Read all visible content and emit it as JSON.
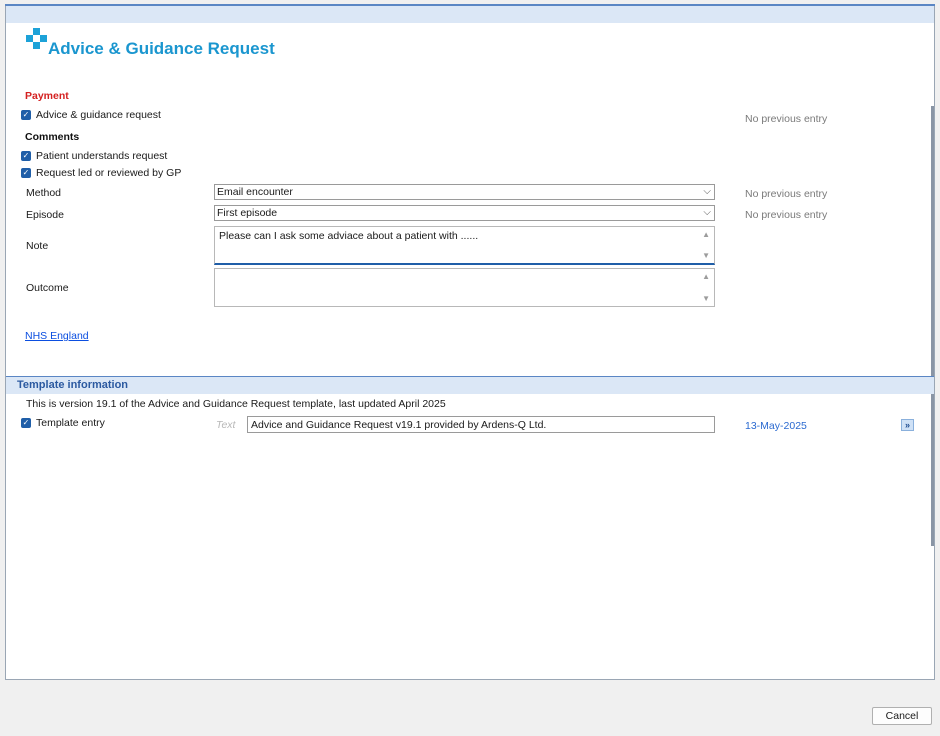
{
  "dialog": {
    "title": "Advice & Guidance Request",
    "brand_color": "#1a96cf"
  },
  "payment": {
    "heading": "Payment",
    "checkbox_label": "Advice & guidance request",
    "previous": "No previous entry"
  },
  "comments": {
    "heading": "Comments",
    "items": [
      "Patient understands request",
      "Request led or reviewed by GP"
    ]
  },
  "method": {
    "label": "Method",
    "value": "Email encounter",
    "previous": "No previous entry"
  },
  "episode": {
    "label": "Episode",
    "value": "First episode",
    "previous": "No previous entry"
  },
  "note": {
    "label": "Note",
    "value": "Please can I ask some adviace about a patient with ......"
  },
  "outcome": {
    "label": "Outcome",
    "value": ""
  },
  "link_text": "NHS England",
  "template_info": {
    "heading": "Template information",
    "description": "This is version 19.1 of the Advice and Guidance Request template, last updated April 2025",
    "entry_label": "Template entry",
    "entry_type": "Text",
    "entry_value": "Advice and Guidance Request v19.1 provided by Ardens-Q Ltd.",
    "date": "13-May-2025"
  },
  "footer": {
    "cancel_label": "Cancel"
  }
}
